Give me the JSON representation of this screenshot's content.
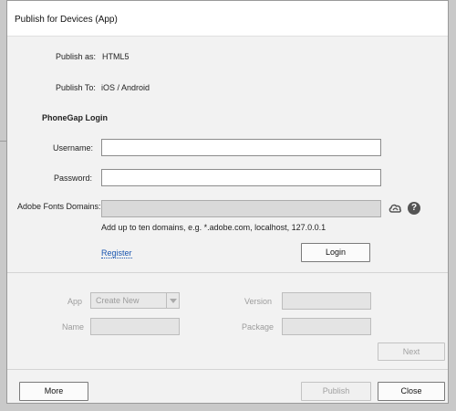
{
  "dialog": {
    "title": "Publish for Devices (App)"
  },
  "info": {
    "publish_as_label": "Publish as:",
    "publish_as_value": "HTML5",
    "publish_to_label": "Publish To:",
    "publish_to_value": "iOS / Android"
  },
  "phonegap": {
    "heading": "PhoneGap Login",
    "username_label": "Username:",
    "username_value": "",
    "password_label": "Password:",
    "password_value": "",
    "fonts_label": "Adobe Fonts Domains:",
    "fonts_value": "",
    "fonts_hint": "Add up to ten domains, e.g. *.adobe.com, localhost, 127.0.0.1",
    "register_link": "Register",
    "login_button": "Login"
  },
  "app": {
    "app_label": "App",
    "app_select_value": "Create New",
    "version_label": "Version",
    "name_label": "Name",
    "package_label": "Package",
    "next_button": "Next"
  },
  "footer": {
    "more_button": "More",
    "publish_button": "Publish",
    "close_button": "Close"
  },
  "icons": {
    "fonts_icon": "creative-cloud-icon",
    "help_icon": "help-icon"
  }
}
